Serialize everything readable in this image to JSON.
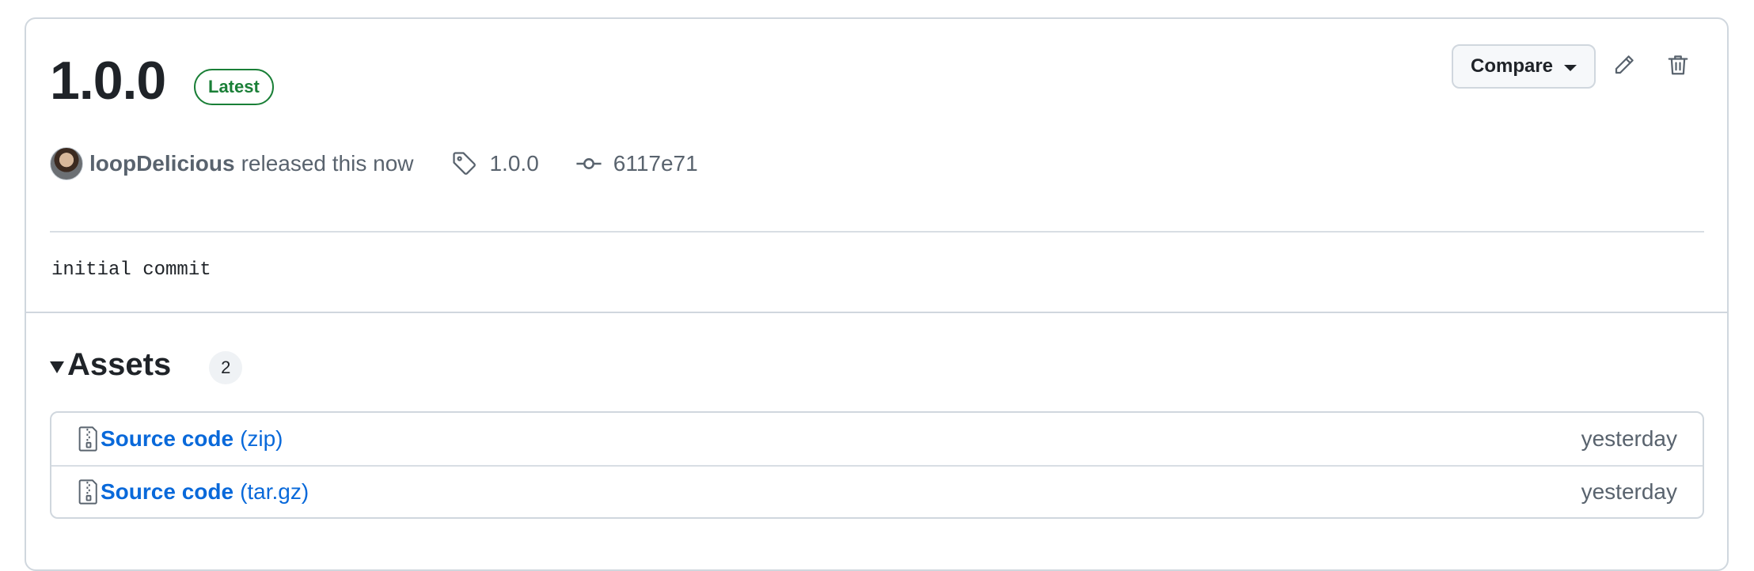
{
  "release": {
    "version": "1.0.0",
    "badge": "Latest",
    "author": "loopDelicious",
    "released_text": "released this now",
    "tag": "1.0.0",
    "commit": "6117e71",
    "body": "initial commit"
  },
  "actions": {
    "compare_label": "Compare",
    "edit_icon": "pencil-icon",
    "delete_icon": "trash-icon"
  },
  "assets": {
    "title": "Assets",
    "count": "2",
    "items": [
      {
        "name": "Source code",
        "ext": "(zip)",
        "date": "yesterday"
      },
      {
        "name": "Source code",
        "ext": "(tar.gz)",
        "date": "yesterday"
      }
    ]
  },
  "colors": {
    "link": "#0969da",
    "badge_green": "#1a7f37",
    "muted_text": "#59636e",
    "border": "#d0d7de"
  }
}
